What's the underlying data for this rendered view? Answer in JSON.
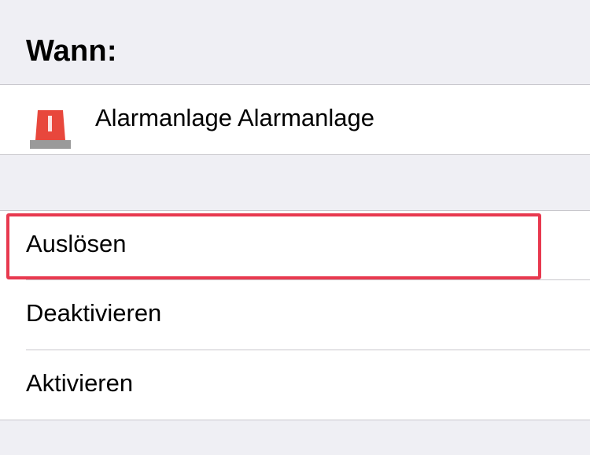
{
  "header": {
    "title": "Wann:"
  },
  "device": {
    "icon": "siren-icon",
    "label": "Alarmanlage Alarmanlage"
  },
  "actions": [
    {
      "label": "Auslösen",
      "selected": true
    },
    {
      "label": "Deaktivieren",
      "selected": false
    },
    {
      "label": "Aktivieren",
      "selected": false
    }
  ],
  "colors": {
    "background": "#efeff4",
    "cell": "#ffffff",
    "separator": "#c8c7cc",
    "highlight": "#e8394f",
    "siren_red": "#e8473c",
    "siren_base": "#9a9a9a"
  }
}
